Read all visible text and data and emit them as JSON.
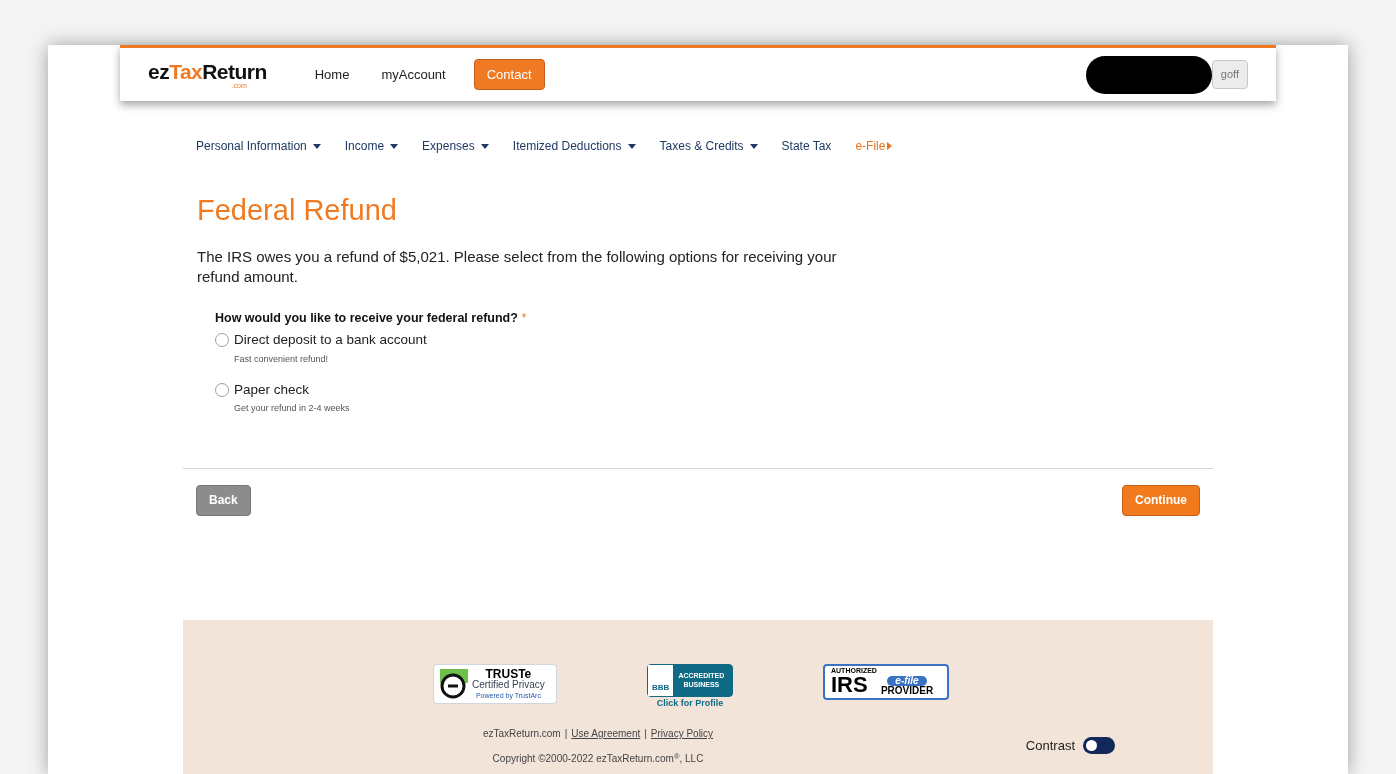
{
  "header": {
    "logo": {
      "parts": [
        {
          "text": "ez",
          "accent": false
        },
        {
          "text": "Tax",
          "accent": true
        },
        {
          "text": "Return",
          "accent": false
        }
      ],
      "sub": ".com"
    },
    "links": [
      {
        "label": "Home",
        "kind": "plain"
      },
      {
        "label": "myAccount",
        "kind": "plain"
      },
      {
        "label": "Contact",
        "kind": "button"
      }
    ],
    "logoff": "goff"
  },
  "nav": [
    {
      "label": "Personal Information",
      "kind": "dropdown"
    },
    {
      "label": "Income",
      "kind": "dropdown"
    },
    {
      "label": "Expenses",
      "kind": "dropdown"
    },
    {
      "label": "Itemized Deductions",
      "kind": "dropdown"
    },
    {
      "label": "Taxes & Credits",
      "kind": "dropdown"
    },
    {
      "label": "State Tax",
      "kind": "link"
    },
    {
      "label": "e-File",
      "kind": "next"
    }
  ],
  "title": "Federal Refund",
  "intro": "The IRS owes you a refund of $5,021. Please select from the following options for receiving your refund amount.",
  "question": {
    "label": "How would you like to receive your federal refund?",
    "required_mark": "*",
    "options": [
      {
        "label": "Direct deposit to a bank account",
        "hint": "Fast convenient refund!",
        "selected": false
      },
      {
        "label": "Paper check",
        "hint": "Get your refund in 2-4 weeks",
        "selected": false
      }
    ]
  },
  "buttons": {
    "back": "Back",
    "continue": "Continue"
  },
  "footer": {
    "badges": [
      {
        "kind": "truste",
        "title": "TRUSTe",
        "line": "Certified Privacy",
        "sub": "Powered by TrustArc"
      },
      {
        "kind": "bbb",
        "mark": "BBB",
        "line": "ACCREDITED BUSINESS",
        "sub": "Click for Profile"
      },
      {
        "kind": "irs",
        "top": "AUTHORIZED",
        "mark": "IRS",
        "tag": "e-file",
        "line": "PROVIDER"
      }
    ],
    "separator": "|",
    "links": [
      {
        "label": "ezTaxReturn.com",
        "kind": "text"
      },
      {
        "label": "Use Agreement",
        "kind": "link"
      },
      {
        "label": "Privacy Policy",
        "kind": "link"
      }
    ],
    "contrast": {
      "label": "Contrast",
      "on": false
    },
    "copyright": "Copyright ©2000-2022 ezTaxReturn.com$^{®}$, LLC"
  }
}
